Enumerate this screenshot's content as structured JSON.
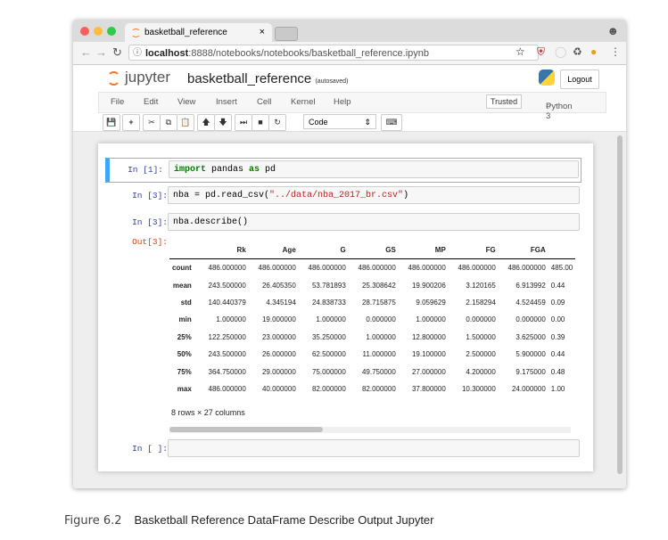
{
  "browser": {
    "tab_title": "basketball_reference",
    "tab_close": "×",
    "url_host": "localhost",
    "url_rest": ":8888/notebooks/notebooks/basketball_reference.ipynb"
  },
  "jupyter": {
    "logo_text": "jupyter",
    "notebook_name": "basketball_reference",
    "autosave": "(autosaved)",
    "logout": "Logout",
    "menu": [
      "File",
      "Edit",
      "View",
      "Insert",
      "Cell",
      "Kernel",
      "Help"
    ],
    "trusted": "Trusted",
    "kernel": "Python 3",
    "cell_type": "Code"
  },
  "cells": [
    {
      "prompt": "In [1]:",
      "code_kw": "import",
      "code_mid": " pandas ",
      "code_kw2": "as",
      "code_end": " pd"
    },
    {
      "prompt": "In [3]:",
      "code_pre": "nba = pd.read_csv(",
      "code_str": "\"../data/nba_2017_br.csv\"",
      "code_post": ")"
    },
    {
      "prompt": "In [3]:",
      "code": "nba.describe()",
      "out_prompt": "Out[3]:"
    },
    {
      "prompt": "In [ ]:"
    }
  ],
  "table": {
    "columns": [
      "Rk",
      "Age",
      "G",
      "GS",
      "MP",
      "FG",
      "FGA",
      ""
    ],
    "rows": [
      [
        "count",
        "486.000000",
        "486.000000",
        "486.000000",
        "486.000000",
        "486.000000",
        "486.000000",
        "486.000000",
        "485.00"
      ],
      [
        "mean",
        "243.500000",
        "26.405350",
        "53.781893",
        "25.308642",
        "19.900206",
        "3.120165",
        "6.913992",
        "0.44"
      ],
      [
        "std",
        "140.440379",
        "4.345194",
        "24.838733",
        "28.715875",
        "9.059629",
        "2.158294",
        "4.524459",
        "0.09"
      ],
      [
        "min",
        "1.000000",
        "19.000000",
        "1.000000",
        "0.000000",
        "1.000000",
        "0.000000",
        "0.000000",
        "0.00"
      ],
      [
        "25%",
        "122.250000",
        "23.000000",
        "35.250000",
        "1.000000",
        "12.800000",
        "1.500000",
        "3.625000",
        "0.39"
      ],
      [
        "50%",
        "243.500000",
        "26.000000",
        "62.500000",
        "11.000000",
        "19.100000",
        "2.500000",
        "5.900000",
        "0.44"
      ],
      [
        "75%",
        "364.750000",
        "29.000000",
        "75.000000",
        "49.750000",
        "27.000000",
        "4.200000",
        "9.175000",
        "0.48"
      ],
      [
        "max",
        "486.000000",
        "40.000000",
        "82.000000",
        "82.000000",
        "37.800000",
        "10.300000",
        "24.000000",
        "1.00"
      ]
    ],
    "summary": "8 rows × 27 columns"
  },
  "caption": {
    "figure": "Figure 6.2",
    "text": "Basketball Reference DataFrame Describe Output Jupyter"
  }
}
